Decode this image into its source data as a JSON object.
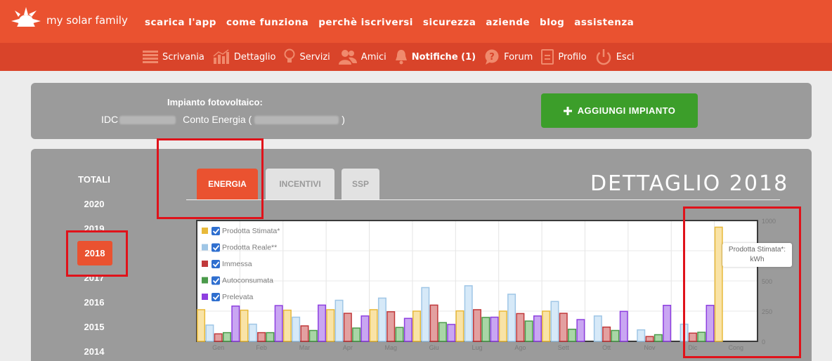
{
  "brand": {
    "name": "my solar family"
  },
  "topnav": [
    "scarica l'app",
    "come funziona",
    "perchè iscriversi",
    "sicurezza",
    "aziende",
    "blog",
    "assistenza"
  ],
  "subnav": [
    {
      "label": "Scrivania",
      "icon": "desk-list-icon"
    },
    {
      "label": "Dettaglio",
      "icon": "bar-chart-icon"
    },
    {
      "label": "Servizi",
      "icon": "lightbulb-icon"
    },
    {
      "label": "Amici",
      "icon": "friends-icon"
    },
    {
      "label": "Notifiche (1)",
      "icon": "bell-icon",
      "bold": true
    },
    {
      "label": "Forum",
      "icon": "forum-bubble-icon"
    },
    {
      "label": "Profilo",
      "icon": "profile-card-icon"
    },
    {
      "label": "Esci",
      "icon": "power-icon"
    }
  ],
  "plant": {
    "title": "Impianto fotovoltaico:",
    "id_prefix": "IDC",
    "conto": "Conto Energia (",
    "close_paren": ")",
    "add_button": "AGGIUNGI IMPIANTO"
  },
  "years": {
    "items": [
      "TOTALI",
      "2020",
      "2019",
      "2018",
      "2017",
      "2016",
      "2015",
      "2014"
    ],
    "selected": "2018"
  },
  "tabs": [
    "ENERGIA",
    "INCENTIVI",
    "SSP"
  ],
  "active_tab": "ENERGIA",
  "heading": "DETTAGLIO 2018",
  "tooltip": {
    "line1": "Prodotta Stimata*:",
    "line2": "kWh"
  },
  "colors": {
    "brand": "#ea5230",
    "subbar": "#d9442a",
    "panel": "#9b9b9b",
    "add_button": "#3c9e2a",
    "highlight": "#e0121a"
  },
  "chart_data": {
    "type": "bar",
    "categories": [
      "Gen",
      "Feb",
      "Mar",
      "Apr",
      "Mag",
      "Giu",
      "Lug",
      "Ago",
      "Sett",
      "Ott",
      "Nov",
      "Dic",
      "Cong"
    ],
    "ylim": [
      0,
      1000
    ],
    "y_ticks": [
      0,
      250,
      500,
      1000
    ],
    "grid": true,
    "legend_position": "top-left",
    "series": [
      {
        "name": "Prodotta Stimata*",
        "color": "#e8b93a",
        "fill": "#f9e3a6",
        "values": [
          262,
          258,
          258,
          262,
          262,
          250,
          252,
          250,
          250,
          0,
          0,
          0,
          945
        ]
      },
      {
        "name": "Prodotta Reale**",
        "color": "#9fc6e6",
        "fill": "#d6e9f8",
        "values": [
          135,
          142,
          200,
          340,
          358,
          445,
          460,
          390,
          330,
          210,
          95,
          142,
          0
        ]
      },
      {
        "name": "Immessa",
        "color": "#c0393b",
        "fill": "#e3a0a0",
        "values": [
          62,
          72,
          128,
          232,
          245,
          300,
          262,
          230,
          232,
          118,
          40,
          68,
          0
        ]
      },
      {
        "name": "Autoconsumata",
        "color": "#4a9a4a",
        "fill": "#a9d6a6",
        "values": [
          72,
          72,
          90,
          110,
          115,
          155,
          198,
          168,
          100,
          90,
          55,
          75,
          0
        ]
      },
      {
        "name": "Prelevata",
        "color": "#8e3fe0",
        "fill": "#c9a6f2",
        "values": [
          292,
          296,
          300,
          210,
          190,
          140,
          200,
          210,
          180,
          248,
          298,
          298,
          0
        ]
      }
    ]
  }
}
